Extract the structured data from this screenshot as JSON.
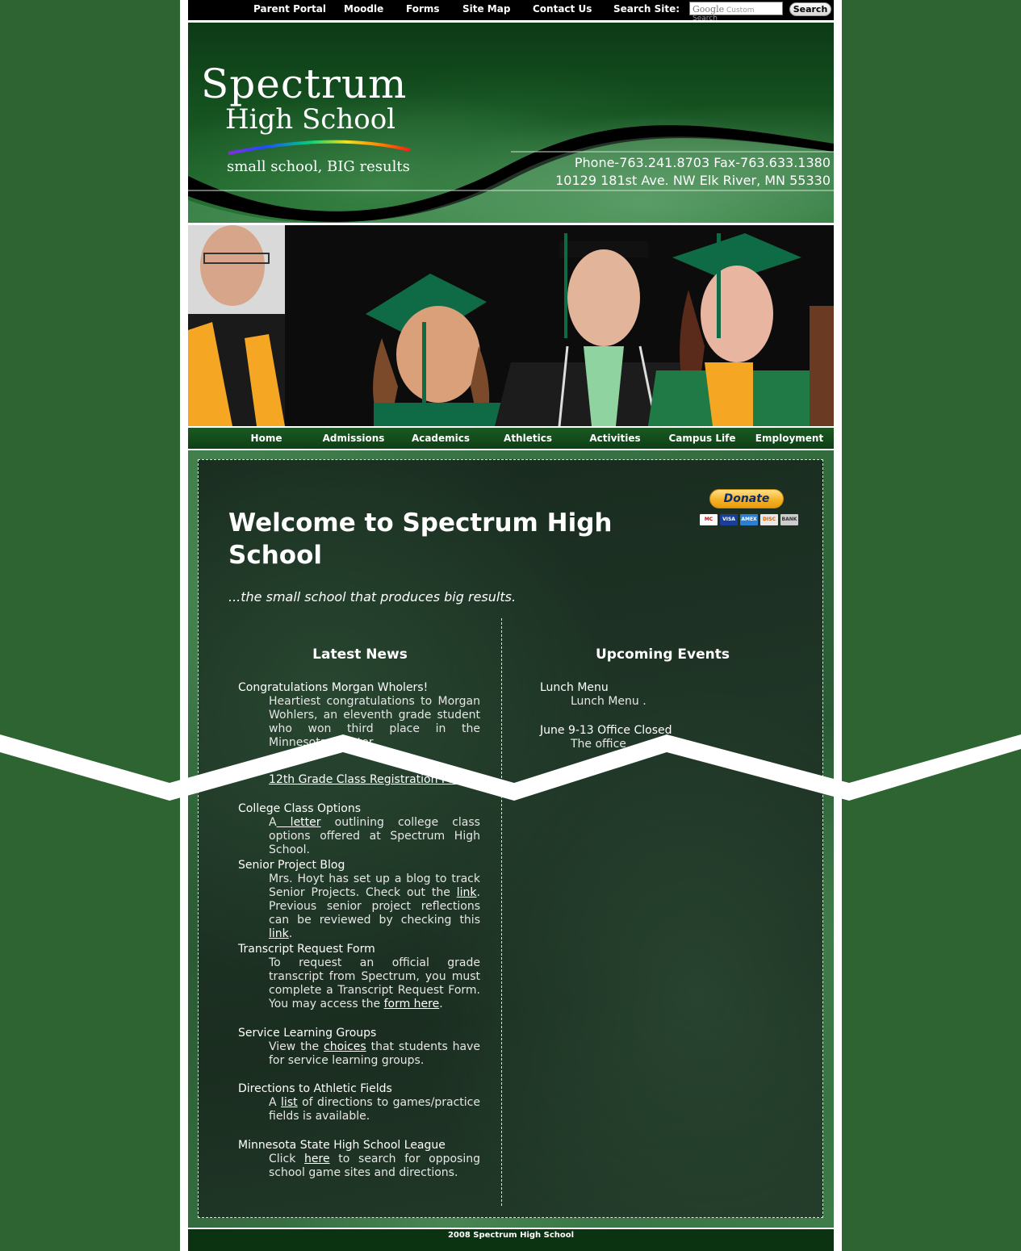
{
  "topbar": {
    "links": [
      "Parent Portal",
      "Moodle",
      "Forms",
      "Site Map",
      "Contact Us"
    ],
    "search_label": "Search Site:",
    "search_placeholder_brand": "Google",
    "search_placeholder": "Custom Search",
    "search_button": "Search"
  },
  "header": {
    "logo_line1": "Spectrum",
    "logo_line2": "High School",
    "logo_tagline": "small school, BIG results",
    "phone_fax": "Phone-763.241.8703  Fax-763.633.1380",
    "address": "10129 181st Ave. NW Elk River, MN 55330"
  },
  "nav": {
    "items": [
      "Home",
      "Admissions",
      "Academics",
      "Athletics",
      "Activities",
      "Campus Life",
      "Employment"
    ]
  },
  "main": {
    "title": "Welcome to Spectrum High School",
    "tagline": "...the small school that produces big results.",
    "donate_label": "Donate",
    "cards": [
      "MC",
      "VISA",
      "AMEX",
      "DISC",
      "BANK"
    ]
  },
  "news": {
    "heading": "Latest News",
    "items": [
      {
        "title": "Congratulations Morgan Wholers!",
        "body": "Heartiest congratulations to Morgan Wohlers, an eleventh grade student who won third place in the Minnesota Charter"
      },
      {
        "link_text": "12th Grade Class Registration Form"
      },
      {
        "title": "College Class Options",
        "body_pre": "A",
        "link": " letter",
        "body_post": " outlining college class options offered at Spectrum High School."
      },
      {
        "title": "Senior Project Blog",
        "body_pre": "Mrs. Hoyt has set up a blog to track Senior Projects. Check out the ",
        "link": "link",
        "body_mid": ". Previous senior project reflections can be reviewed by checking this ",
        "link2": "link",
        "body_post": "."
      },
      {
        "title": "Transcript Request Form",
        "body_pre": "To request an official grade transcript from Spectrum, you must complete a Transcript Request Form. You may access the ",
        "link": "form here",
        "body_post": "."
      },
      {
        "title": "Service Learning Groups",
        "body_pre": "View the ",
        "link": "choices",
        "body_post": " that students have for service learning groups."
      },
      {
        "title": "Directions to Athletic Fields",
        "body_pre": "A ",
        "link": "list",
        "body_post": " of directions to games/practice fields is available."
      },
      {
        "title": "Minnesota State High School League",
        "body_pre": "Click ",
        "link": "here",
        "body_post": " to search for opposing school game sites and directions."
      }
    ]
  },
  "events": {
    "heading": "Upcoming Events",
    "items": [
      {
        "title": "Lunch Menu",
        "body": "Lunch Menu ."
      },
      {
        "title": "June 9-13 Office Closed",
        "body": "The office"
      }
    ]
  },
  "footer": {
    "text": "2008 Spectrum High School"
  },
  "colors": {
    "page_bg": "#2e6431",
    "nav_bg": "#0e3f16",
    "topbar_bg": "#000000"
  }
}
